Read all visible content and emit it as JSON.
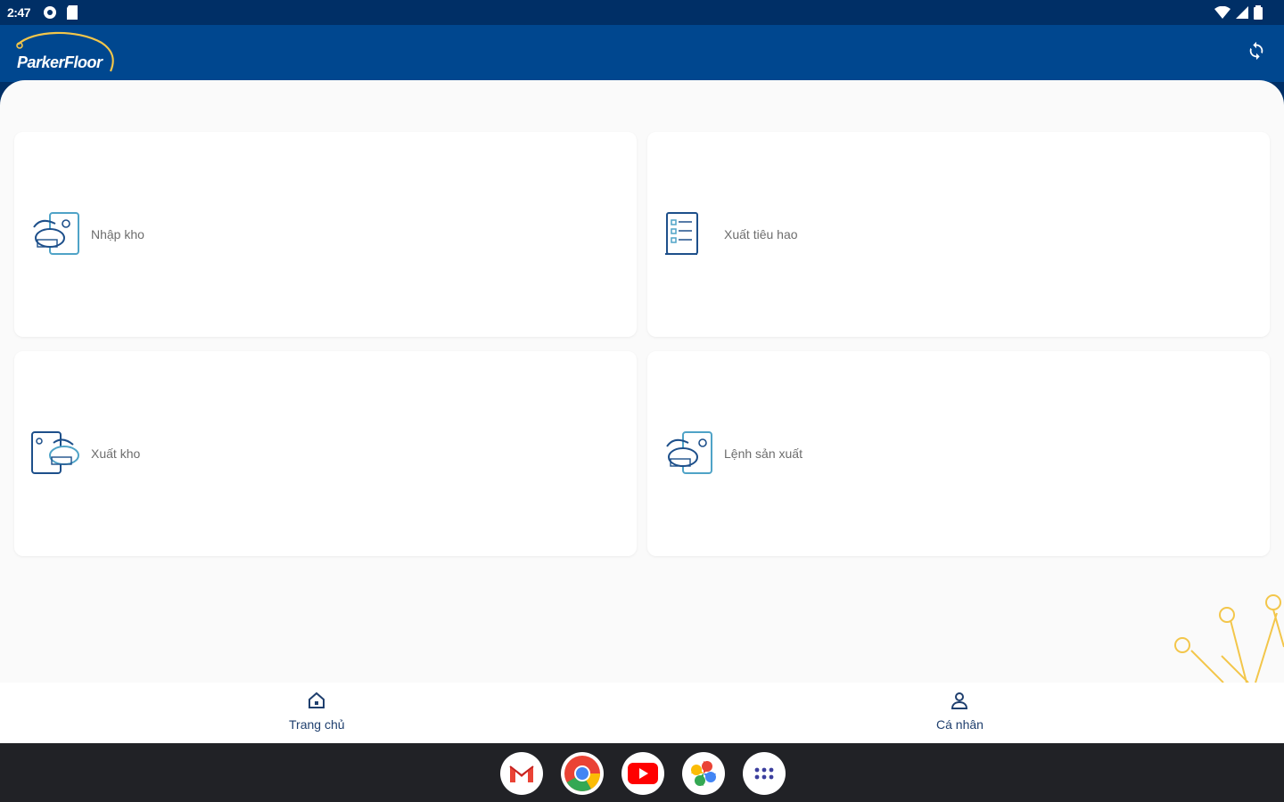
{
  "status_bar": {
    "time": "2:47",
    "left_icons": [
      "settings-status-icon",
      "sd-card-icon"
    ],
    "right_icons": [
      "wifi-icon",
      "signal-icon",
      "battery-icon"
    ]
  },
  "app_bar": {
    "logo_text": "ParkerFloor",
    "sync_icon": "sync-icon"
  },
  "menu": {
    "items": [
      {
        "label": "Nhập kho",
        "icon": "warehouse-import-icon"
      },
      {
        "label": "Xuất tiêu hao",
        "icon": "consumption-list-icon"
      },
      {
        "label": "Xuất kho",
        "icon": "warehouse-export-icon"
      },
      {
        "label": "Lệnh sản xuất",
        "icon": "production-order-icon"
      }
    ]
  },
  "bottom_nav": {
    "home_label": "Trang chủ",
    "profile_label": "Cá nhân"
  },
  "taskbar": {
    "apps": [
      "gmail-icon",
      "chrome-icon",
      "youtube-icon",
      "photos-icon",
      "app-drawer-icon"
    ]
  },
  "colors": {
    "status_bar": "#002f66",
    "app_bar": "#00478f",
    "icon_blue": "#1d4f8a",
    "icon_teal": "#4fa3c7",
    "accent_gold": "#f3c64a",
    "taskbar": "#212226"
  }
}
